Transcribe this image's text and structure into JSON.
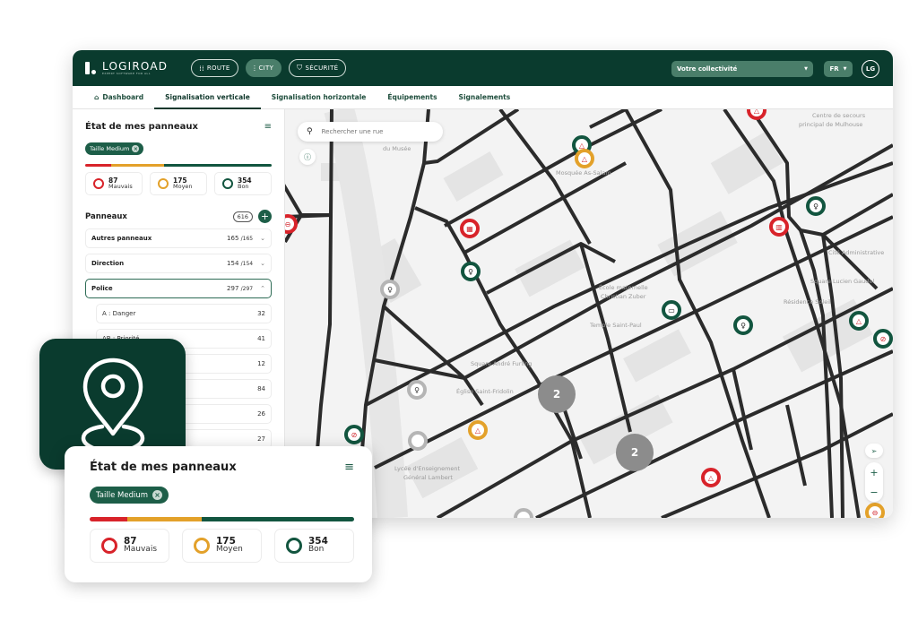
{
  "brand": {
    "name": "LOGIROAD",
    "tagline": "EXPERT SOFTWARE FOR ALL"
  },
  "modules": [
    {
      "label": "ROUTE",
      "icon": "road-icon",
      "active": false
    },
    {
      "label": "CITY",
      "icon": "city-icon",
      "active": true
    },
    {
      "label": "SÉCURITÉ",
      "icon": "shield-icon",
      "active": false
    }
  ],
  "header": {
    "collectivite": "Votre collectivité",
    "lang": "FR",
    "user_initials": "LG"
  },
  "tabs": [
    {
      "label": "Dashboard",
      "icon": "home-icon",
      "active": false
    },
    {
      "label": "Signalisation verticale",
      "active": true
    },
    {
      "label": "Signalisation horizontale",
      "active": false
    },
    {
      "label": "Équipements",
      "active": false
    },
    {
      "label": "Signalements",
      "active": false
    }
  ],
  "sidebar": {
    "title": "État de mes panneaux",
    "filter_chip": "Taille Medium",
    "status": [
      {
        "count": "87",
        "label": "Mauvais",
        "color": "#d8232a",
        "share": 0.141
      },
      {
        "count": "175",
        "label": "Moyen",
        "color": "#e3a12a",
        "share": 0.284
      },
      {
        "count": "354",
        "label": "Bon",
        "color": "#12553f",
        "share": 0.575
      }
    ],
    "panneaux_title": "Panneaux",
    "panneaux_count": "616",
    "categories": [
      {
        "name": "Autres panneaux",
        "count": "165",
        "total": "/165",
        "open": false
      },
      {
        "name": "Direction",
        "count": "154",
        "total": "/154",
        "open": false
      },
      {
        "name": "Police",
        "count": "297",
        "total": "/297",
        "open": true
      }
    ],
    "subcategories": [
      {
        "name": "A : Danger",
        "count": "32"
      },
      {
        "name": "AB : Priorité",
        "count": "41"
      },
      {
        "name": "",
        "count": "12"
      },
      {
        "name": "",
        "count": "84"
      },
      {
        "name": "",
        "count": "26"
      },
      {
        "name": "",
        "count": "27"
      }
    ]
  },
  "map": {
    "search_placeholder": "Rechercher une rue",
    "labels": [
      "Centre de secours",
      "principal de Mulhouse",
      "du Musée",
      "Mosquée As-Salam",
      "Cité Administrative",
      "École maternelle",
      "Christian Zuber",
      "Temple Saint-Paul",
      "Résidence Soleil",
      "Square Lucien Gaudel",
      "Square André Furling",
      "Église Saint-Fridolin",
      "Lycée d'Enseignement",
      "Général Lambert"
    ],
    "clusters": [
      "2",
      "2"
    ]
  },
  "card": {
    "title": "État de mes panneaux",
    "filter_chip": "Taille Medium",
    "status": [
      {
        "count": "87",
        "label": "Mauvais"
      },
      {
        "count": "175",
        "label": "Moyen"
      },
      {
        "count": "354",
        "label": "Bon"
      }
    ]
  }
}
